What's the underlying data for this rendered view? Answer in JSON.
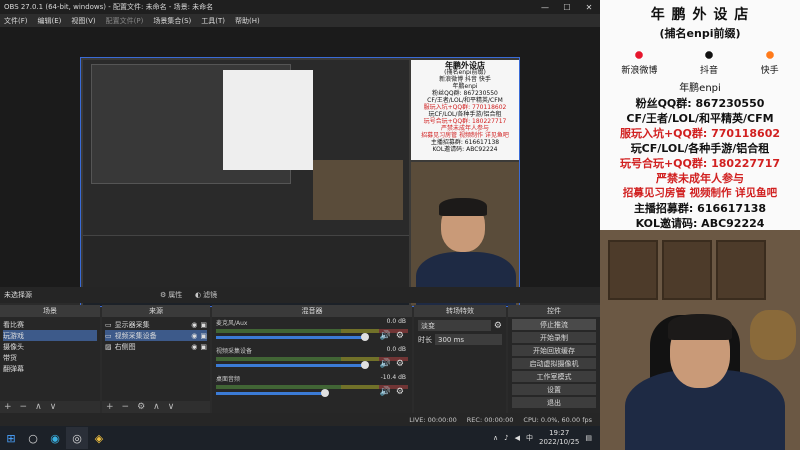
{
  "window": {
    "title": "OBS 27.0.1 (64-bit, windows) - 配置文件: 未命名 - 场景: 未命名",
    "controls": [
      "—",
      "☐",
      "✕"
    ]
  },
  "menu": [
    "文件(F)",
    "编辑(E)",
    "视图(V)",
    "配置文件(P)",
    "场景集合(S)",
    "工具(T)",
    "帮助(H)"
  ],
  "preview": {
    "nested_panel_lines": [
      "年鹏外设店",
      "(捕名enpi前缀)",
      "新浪微博  抖音  快手",
      "年鹏enpi",
      "粉丝QQ群: 867230550",
      "CF/王者/LOL/和平精英/CFM",
      "服玩入坑+QQ群: 770118602",
      "玩CF/LOL/各种手游/铝合租",
      "玩号合玩+QQ群: 180227717",
      "严禁未成年人参与",
      "招募见习房管 视频制作 详见鱼吧",
      "主播招募群: 616617138",
      "KOL邀请码: ABC92224"
    ]
  },
  "source_bar": {
    "label": "未选择源",
    "props_label": "属性",
    "filters_label": "滤镜"
  },
  "docks": {
    "scenes": {
      "title": "场景",
      "items": [
        "看比赛",
        "玩游戏",
        "摄像头",
        "带货",
        "翻弹幕"
      ],
      "selected": 1
    },
    "sources": {
      "title": "来源",
      "items": [
        "显示器采集",
        "视频采集设备",
        "右侧图"
      ],
      "selected": 1
    },
    "mixer": {
      "title": "混音器",
      "channels": [
        {
          "name": "麦克风/Aux",
          "db": "0.0 dB"
        },
        {
          "name": "视频采集设备",
          "db": "0.0 dB"
        },
        {
          "name": "桌面音频",
          "db": "-10.4 dB"
        }
      ]
    },
    "transitions": {
      "title": "转场特效",
      "type": "淡变",
      "duration_label": "时长",
      "duration_value": "300 ms"
    },
    "controls": {
      "title": "控件",
      "buttons": [
        "停止推流",
        "开始录制",
        "开始回放缓存",
        "启动虚拟摄像机",
        "工作室模式",
        "设置",
        "退出"
      ]
    }
  },
  "status": {
    "live": "LIVE: 00:00:00",
    "rec": "REC: 00:00:00",
    "cpu": "CPU: 0.0%, 60.00 fps"
  },
  "taskbar": {
    "time": "19:27",
    "date": "2022/10/25",
    "lang": "中"
  },
  "overlay": {
    "title": "年 鹏 外 设 店",
    "subtitle": "(捕名enpi前缀)",
    "social": [
      "新浪微博",
      "抖音",
      "快手"
    ],
    "handle": "年鹏enpi",
    "lines": [
      {
        "text": "粉丝QQ群: 867230550",
        "red": false
      },
      {
        "text": "CF/王者/LOL/和平精英/CFM",
        "red": false
      },
      {
        "text": "服玩入坑+QQ群: 770118602",
        "red": true
      },
      {
        "text": "玩CF/LOL/各种手游/铝合租",
        "red": false
      },
      {
        "text": "玩号合玩+QQ群: 180227717",
        "red": true
      },
      {
        "text": "严禁未成年人参与",
        "red": true
      },
      {
        "text": "招募见习房管 视频制作 详见鱼吧",
        "red": true
      },
      {
        "text": "主播招募群: 616617138",
        "red": false
      },
      {
        "text": "KOL邀请码: ABC92224",
        "red": false
      }
    ]
  },
  "colors": {
    "accent": "#3a6bd6",
    "red": "#d12020",
    "selection": "#3d5a8a"
  }
}
